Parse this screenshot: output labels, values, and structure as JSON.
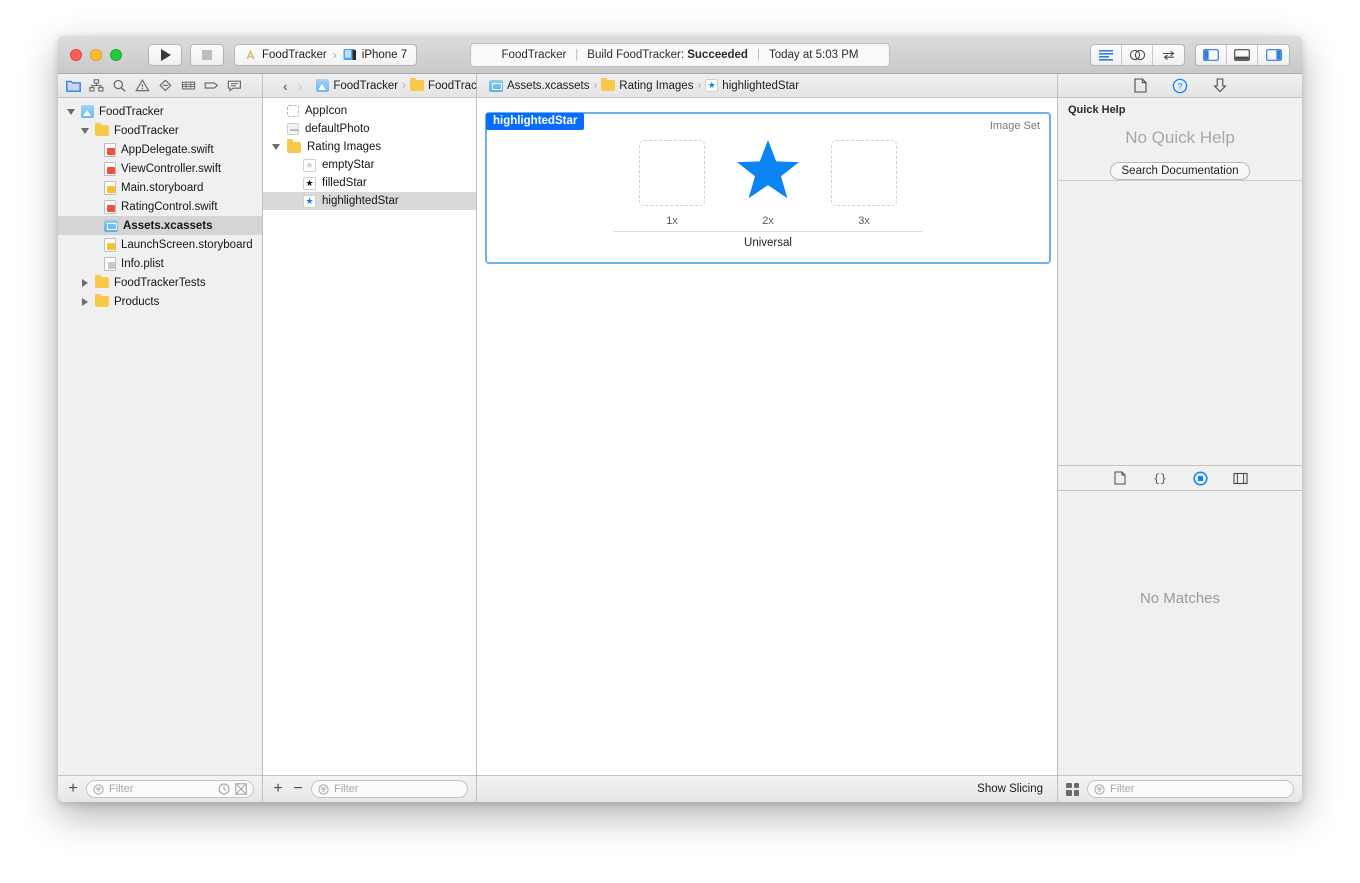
{
  "window": {
    "traffic_lights": [
      "close",
      "minimize",
      "zoom"
    ],
    "toolbar": {
      "run_label": "Run",
      "stop_label": "Stop",
      "scheme_project": "FoodTracker",
      "scheme_separator": "›",
      "scheme_destination": "iPhone 7",
      "status": {
        "project": "FoodTracker",
        "divider": "|",
        "activity_prefix": "Build FoodTracker:",
        "activity_result": "Succeeded",
        "timestamp": "Today at 5:03 PM"
      },
      "editor_modes": [
        "standard-editor-icon",
        "assistant-editor-icon",
        "version-editor-icon"
      ],
      "view_toggles": [
        "navigator-toggle-icon",
        "debug-area-toggle-icon",
        "utilities-toggle-icon"
      ]
    }
  },
  "navigator": {
    "tabs": [
      "project-navigator-icon",
      "source-control-navigator-icon",
      "find-navigator-icon",
      "issue-navigator-icon",
      "test-navigator-icon",
      "debug-navigator-icon",
      "breakpoint-navigator-icon",
      "report-navigator-icon"
    ],
    "active_tab": "project-navigator-icon",
    "tree": [
      {
        "label": "FoodTracker",
        "icon": "project-icon",
        "indent": 0,
        "disclosure": "down",
        "selected": false
      },
      {
        "label": "FoodTracker",
        "icon": "folder-icon",
        "indent": 1,
        "disclosure": "down",
        "selected": false
      },
      {
        "label": "AppDelegate.swift",
        "icon": "swift-file-icon",
        "indent": 2,
        "disclosure": "none",
        "selected": false
      },
      {
        "label": "ViewController.swift",
        "icon": "swift-file-icon",
        "indent": 2,
        "disclosure": "none",
        "selected": false
      },
      {
        "label": "Main.storyboard",
        "icon": "storyboard-file-icon",
        "indent": 2,
        "disclosure": "none",
        "selected": false
      },
      {
        "label": "RatingControl.swift",
        "icon": "swift-file-icon",
        "indent": 2,
        "disclosure": "none",
        "selected": false
      },
      {
        "label": "Assets.xcassets",
        "icon": "xcassets-icon",
        "indent": 2,
        "disclosure": "none",
        "selected": true
      },
      {
        "label": "LaunchScreen.storyboard",
        "icon": "storyboard-file-icon",
        "indent": 2,
        "disclosure": "none",
        "selected": false
      },
      {
        "label": "Info.plist",
        "icon": "plist-file-icon",
        "indent": 2,
        "disclosure": "none",
        "selected": false
      },
      {
        "label": "FoodTrackerTests",
        "icon": "folder-icon",
        "indent": 1,
        "disclosure": "right",
        "selected": false
      },
      {
        "label": "Products",
        "icon": "folder-icon",
        "indent": 1,
        "disclosure": "right",
        "selected": false
      }
    ],
    "footer": {
      "add_label": "+",
      "filter_placeholder": "Filter",
      "filter_value": "",
      "recent_icon": "clock-icon",
      "source-control-icon": "source-control-filter-icon"
    }
  },
  "catalog": {
    "header": {
      "related_items_icon": "related-items-icon",
      "back_label": "‹",
      "forward_label": "›"
    },
    "items": [
      {
        "label": "AppIcon",
        "icon": "appicon-placeholder-icon",
        "indent": 0,
        "disclosure": "none",
        "selected": false
      },
      {
        "label": "defaultPhoto",
        "icon": "image-placeholder-icon",
        "indent": 0,
        "disclosure": "none",
        "selected": false
      },
      {
        "label": "Rating Images",
        "icon": "folder-icon",
        "indent": 0,
        "disclosure": "down",
        "selected": false
      },
      {
        "label": "emptyStar",
        "icon": "empty-star-icon",
        "indent": 1,
        "disclosure": "none",
        "selected": false
      },
      {
        "label": "filledStar",
        "icon": "filled-star-icon",
        "indent": 1,
        "disclosure": "none",
        "selected": false
      },
      {
        "label": "highlightedStar",
        "icon": "highlighted-star-icon",
        "indent": 1,
        "disclosure": "none",
        "selected": true
      }
    ],
    "footer": {
      "add_label": "+",
      "remove_label": "−",
      "filter_placeholder": "Filter",
      "filter_value": ""
    }
  },
  "editor": {
    "breadcrumb": [
      {
        "label": "FoodTracker",
        "icon": "project-icon"
      },
      {
        "label": "FoodTracker",
        "icon": "folder-icon"
      },
      {
        "label": "Assets.xcassets",
        "icon": "xcassets-icon"
      },
      {
        "label": "Rating Images",
        "icon": "folder-icon"
      },
      {
        "label": "highlightedStar",
        "icon": "highlighted-star-icon"
      }
    ],
    "breadcrumb_separator": "›",
    "image_set": {
      "name": "highlightedStar",
      "kind": "Image Set",
      "device_label": "Universal",
      "slots": [
        {
          "scale": "1x",
          "filled": false
        },
        {
          "scale": "2x",
          "filled": true,
          "image": "blue-star"
        },
        {
          "scale": "3x",
          "filled": false
        }
      ]
    },
    "footer": {
      "show_slicing_label": "Show Slicing"
    }
  },
  "utilities": {
    "inspector_tabs": [
      "file-inspector-icon",
      "quick-help-inspector-icon",
      "attributes-inspector-icon"
    ],
    "active_inspector_tab": "quick-help-inspector-icon",
    "quick_help": {
      "title": "Quick Help",
      "empty_message": "No Quick Help",
      "search_button": "Search Documentation"
    },
    "library_tabs": [
      "file-template-library-icon",
      "code-snippet-library-icon",
      "object-library-icon",
      "media-library-icon"
    ],
    "active_library_tab": "object-library-icon",
    "library": {
      "empty_message": "No Matches",
      "view_mode_icon": "grid-view-icon",
      "filter_placeholder": "Filter",
      "filter_value": ""
    }
  },
  "colors": {
    "accent_blue": "#0a84ff",
    "selection_blue": "#0a6cff",
    "star_blue": "#0b84f3",
    "folder_yellow": "#f7c84a",
    "swift_orange": "#f05138"
  }
}
